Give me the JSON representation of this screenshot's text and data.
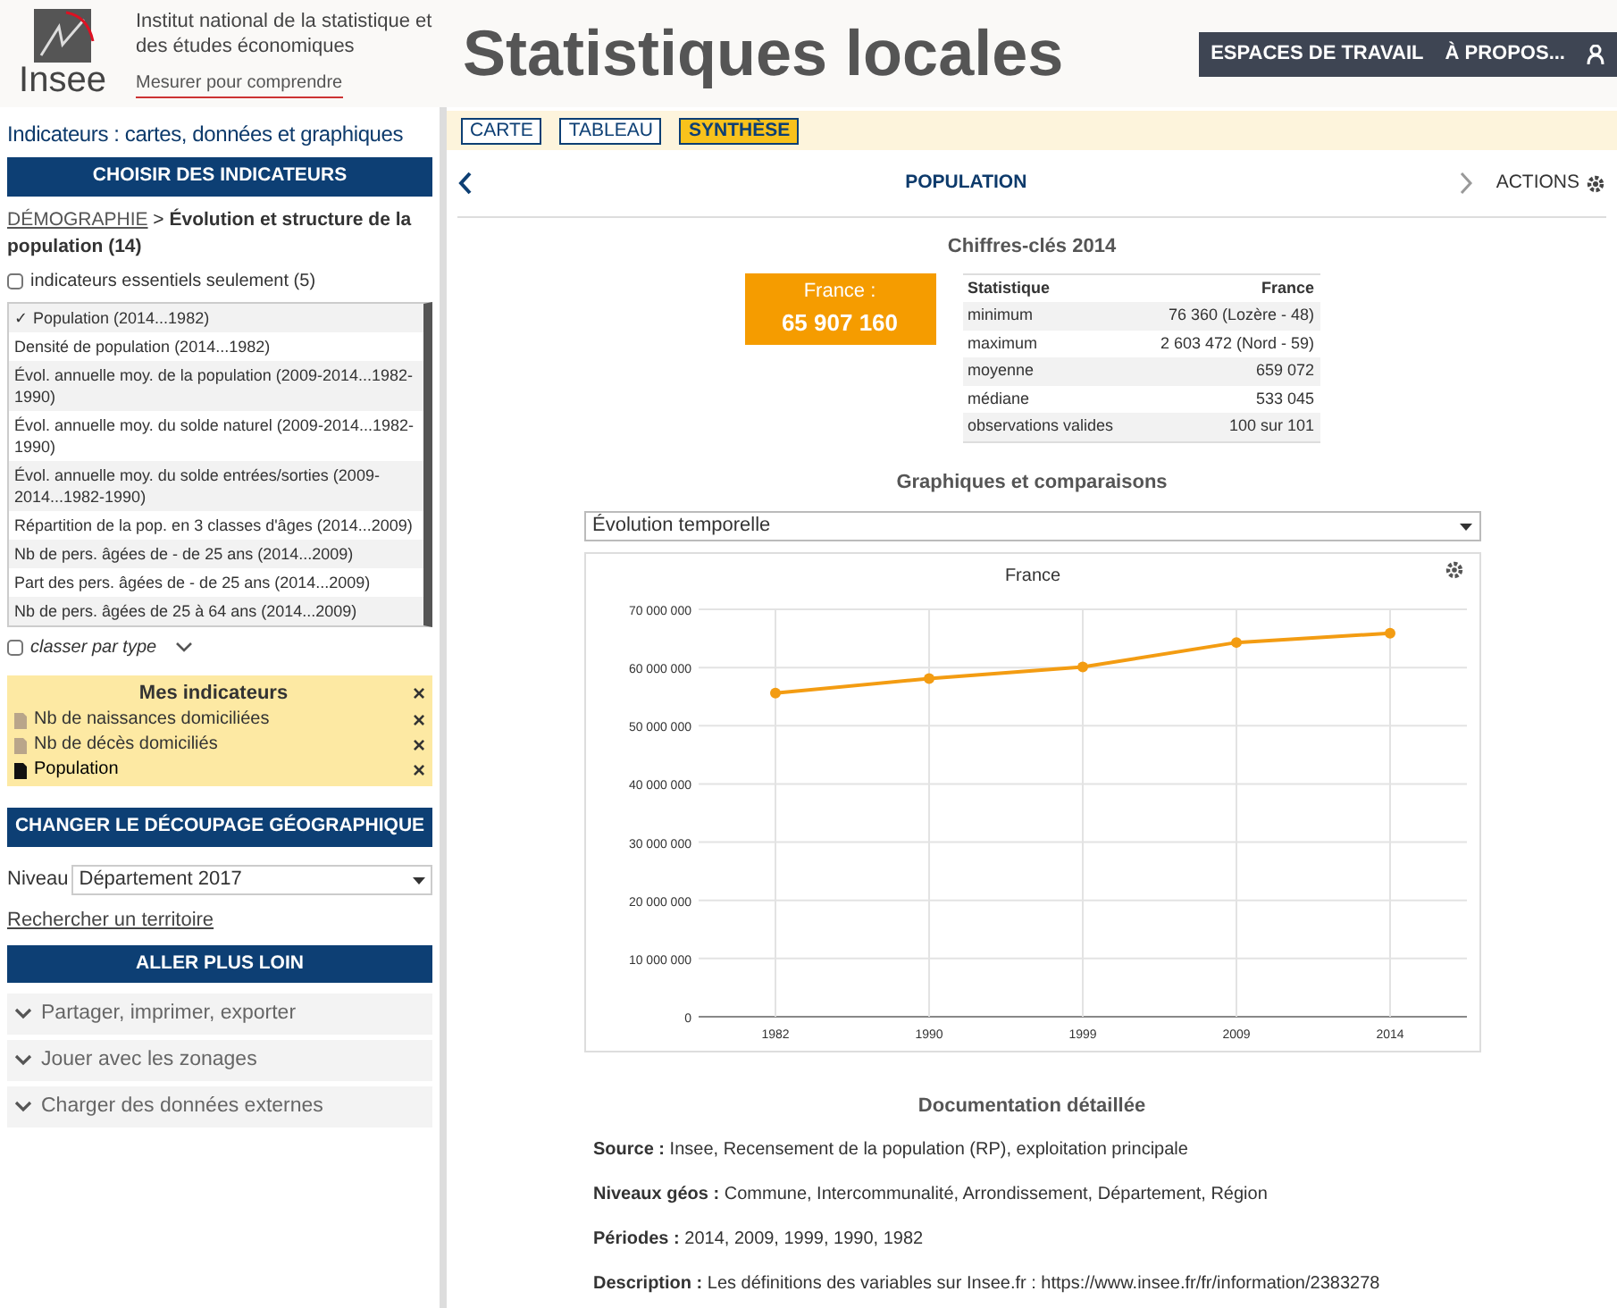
{
  "header": {
    "logo_text": "Insee",
    "org_name": "Institut national de la statistique et des études économiques",
    "tagline": "Mesurer pour comprendre",
    "title": "Statistiques locales",
    "nav": [
      "ESPACES DE TRAVAIL",
      "À PROPOS..."
    ]
  },
  "sidebar": {
    "heading": "Indicateurs : cartes, données et graphiques",
    "choose_header": "CHOISIR DES INDICATEURS",
    "breadcrumb": {
      "link": "DÉMOGRAPHIE",
      "separator": ">",
      "current": "Évolution et structure de la population (14)"
    },
    "essential_only": {
      "label": "indicateurs essentiels seulement (5)",
      "checked": false
    },
    "indicators": [
      {
        "check": "✓",
        "label": "Population (2014...1982)"
      },
      {
        "label": "Densité de population (2014...1982)"
      },
      {
        "label": "Évol. annuelle moy. de la population (2009-2014...1982-1990)"
      },
      {
        "label": "Évol. annuelle moy. du solde naturel (2009-2014...1982-1990)"
      },
      {
        "label": "Évol. annuelle moy. du solde entrées/sorties (2009-2014...1982-1990)"
      },
      {
        "label": "Répartition de la pop. en 3 classes d'âges (2014...2009)"
      },
      {
        "label": "Nb de pers. âgées de - de 25 ans (2014...2009)"
      },
      {
        "label": "Part des pers. âgées de - de 25 ans (2014...2009)"
      },
      {
        "label": "Nb de pers. âgées de 25 à 64 ans (2014...2009)"
      }
    ],
    "sort_by_type": {
      "label": "classer par type",
      "checked": false
    },
    "my_indicators": {
      "title": "Mes indicateurs",
      "close": "×",
      "items": [
        {
          "label": "Nb de naissances domiciliées",
          "selected": false,
          "remove": "×"
        },
        {
          "label": "Nb de décès domiciliés",
          "selected": false,
          "remove": "×"
        },
        {
          "label": "Population",
          "selected": true,
          "remove": "×"
        }
      ]
    },
    "geo_header": "CHANGER LE DÉCOUPAGE GÉOGRAPHIQUE",
    "level": {
      "label": "Niveau",
      "value": "Département 2017"
    },
    "search_link": "Rechercher un territoire",
    "further_header": "ALLER PLUS LOIN",
    "accordions": [
      {
        "label": "Partager, imprimer, exporter",
        "expanded": false
      },
      {
        "label": "Jouer avec les zonages",
        "expanded": false
      },
      {
        "label": "Charger des données externes",
        "expanded": false
      }
    ]
  },
  "main": {
    "tabs": [
      {
        "label": "CARTE",
        "selected": false
      },
      {
        "label": "TABLEAU",
        "selected": false
      },
      {
        "label": "SYNTHÈSE",
        "selected": true
      }
    ],
    "title": "POPULATION",
    "actions": "ACTIONS",
    "key_figures": {
      "title": "Chiffres-clés 2014",
      "highlight_label": "France :",
      "highlight_value": "65 907 160",
      "columns": [
        "Statistique",
        "France"
      ],
      "rows": [
        [
          "minimum",
          "76 360 (Lozère - 48)"
        ],
        [
          "maximum",
          "2 603 472 (Nord - 59)"
        ],
        [
          "moyenne",
          "659 072"
        ],
        [
          "médiane",
          "533 045"
        ],
        [
          "observations valides",
          "100 sur 101"
        ]
      ]
    },
    "charts_title": "Graphiques et comparaisons",
    "chart_select": "Évolution temporelle",
    "chart_data": {
      "type": "line",
      "grid": true,
      "categories": [
        "1982",
        "1990",
        "1999",
        "2009",
        "2014"
      ],
      "series": [
        {
          "name": "France",
          "color": "#f39c12",
          "marker": true,
          "values": [
            55600000,
            58100000,
            60100000,
            64300000,
            65900000
          ]
        }
      ],
      "ylim": [
        0,
        70000000
      ],
      "yticks": [
        {
          "value": 0,
          "label": "0"
        },
        {
          "value": 10000000,
          "label": "10 000 000"
        },
        {
          "value": 20000000,
          "label": "20 000 000"
        },
        {
          "value": 30000000,
          "label": "30 000 000"
        },
        {
          "value": 40000000,
          "label": "40 000 000"
        },
        {
          "value": 50000000,
          "label": "50 000 000"
        },
        {
          "value": 60000000,
          "label": "60 000 000"
        },
        {
          "value": 70000000,
          "label": "70 000 000"
        }
      ]
    },
    "doc_title": "Documentation détaillée",
    "doc": [
      {
        "label": "Source :",
        "value": "Insee, Recensement de la population (RP), exploitation principale"
      },
      {
        "label": "Niveaux géos :",
        "value": "Commune, Intercommunalité, Arrondissement, Département, Région"
      },
      {
        "label": "Périodes :",
        "value": "2014, 2009, 1999, 1990, 1982"
      },
      {
        "label": "Description :",
        "value": "Les définitions des variables sur Insee.fr : https://www.insee.fr/fr/information/2383278"
      }
    ]
  }
}
